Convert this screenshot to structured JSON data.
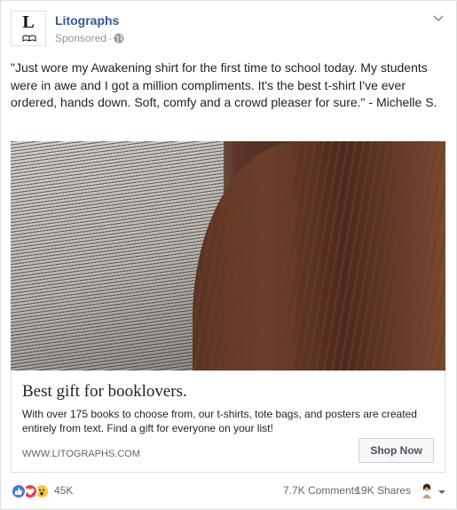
{
  "post": {
    "page_name": "Litographs",
    "logo_letter": "L",
    "sponsored": "Sponsored",
    "text": "\"Just wore my Awakening shirt for the first time to school today. My students were in awe and I got a million compliments. It's the best t-shirt I've ever ordered, hands down. Soft, comfy and a crowd pleaser for sure.\" - Michelle S."
  },
  "ad": {
    "headline": "Best gift for booklovers.",
    "description": "With over 175 books to choose from, our t-shirts, tote bags, and posters are created entirely from text. Find a gift for everyone on your list!",
    "domain": "WWW.LITOGRAPHS.COM",
    "cta_label": "Shop Now"
  },
  "footer": {
    "reaction_count": "45K",
    "comments": "7.7K Comments",
    "shares": "19K Shares"
  },
  "colors": {
    "link": "#365899",
    "like": "#4a78e0",
    "love": "#f0394f",
    "wow": "#f7c740"
  },
  "icons": [
    "book-logo-icon",
    "globe-icon",
    "chevron-down-icon",
    "like-reaction-icon",
    "love-reaction-icon",
    "wow-reaction-icon",
    "viewer-avatar-icon"
  ]
}
